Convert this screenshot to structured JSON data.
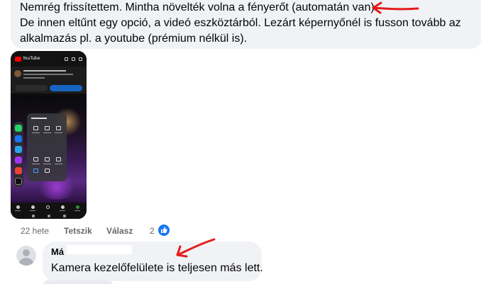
{
  "comment1": {
    "lines": [
      "Nemrég frissítettem. Mintha növelték volna a fényerőt (automatán van).",
      "De innen eltűnt egy opció, a videó eszköztárból. Lezárt képernyőnél is fusson tovább az",
      "alkalmazás pl. a youtube (prémium nélkül is)."
    ],
    "time": "22 hete",
    "like_action": "Tetszik",
    "reply_action": "Válasz",
    "reaction_count": "2"
  },
  "comment2": {
    "author_visible": "Má",
    "text": "Kamera kezelőfelülete is teljesen más lett."
  },
  "colors": {
    "bubble": "#f0f2f5",
    "annotation_arrow": "#e41b1b",
    "like_blue": "#1877f2",
    "meta_gray": "#65676b"
  },
  "icons": {
    "reaction": "thumbs-up-icon",
    "avatar": "default-avatar-icon",
    "annotation": "red-arrow-annotation"
  }
}
